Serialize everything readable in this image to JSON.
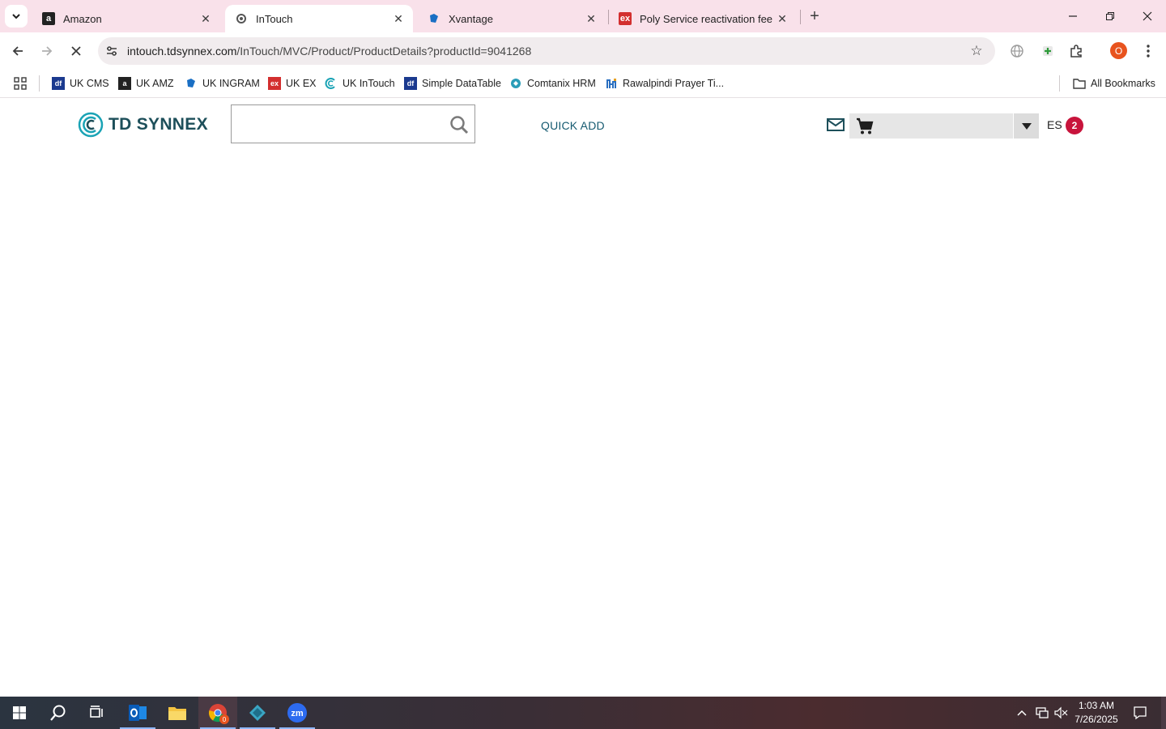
{
  "browser": {
    "tabs": [
      {
        "title": "Amazon",
        "favicon": "amazon-icon"
      },
      {
        "title": "InTouch",
        "favicon": "intouch-icon",
        "active": true
      },
      {
        "title": "Xvantage",
        "favicon": "xvantage-icon"
      },
      {
        "title": "Poly Service reactivation fee Sm",
        "favicon": "ex-icon"
      }
    ],
    "url_host": "intouch.tdsynnex.com",
    "url_path": "/InTouch/MVC/Product/ProductDetails?productId=9041268",
    "profile_initial": "O",
    "bookmarks": [
      {
        "label": "UK CMS",
        "icon": "cms-icon",
        "color": "#1b3a8f"
      },
      {
        "label": "UK AMZ",
        "icon": "amazon-icon",
        "color": "#222222"
      },
      {
        "label": "UK INGRAM",
        "icon": "ingram-icon",
        "color": "#1a6fc4"
      },
      {
        "label": "UK EX",
        "icon": "ex-icon",
        "color": "#d32f2f"
      },
      {
        "label": "UK InTouch",
        "icon": "intouch-icon",
        "color": "#1aa3b5"
      },
      {
        "label": "Simple DataTable",
        "icon": "datatable-icon",
        "color": "#1b3a8f"
      },
      {
        "label": "Comtanix HRM",
        "icon": "hrm-icon",
        "color": "#2a9db8"
      },
      {
        "label": "Rawalpindi Prayer Ti...",
        "icon": "prayer-icon",
        "color": "#2a6fc0"
      }
    ],
    "all_bookmarks": "All Bookmarks"
  },
  "page": {
    "logo_text": "TD SYNNEX",
    "search_value": "",
    "quick_add": "QUICK ADD",
    "user_initials": "ES",
    "notification_count": "2"
  },
  "taskbar": {
    "time": "1:03 AM",
    "date": "7/26/2025",
    "chrome_badge": "0"
  },
  "colors": {
    "tabstrip": "#f9e1ea",
    "brand_teal": "#1aa3b5",
    "brand_dark": "#1d4f5a",
    "badge": "#c8143c"
  }
}
